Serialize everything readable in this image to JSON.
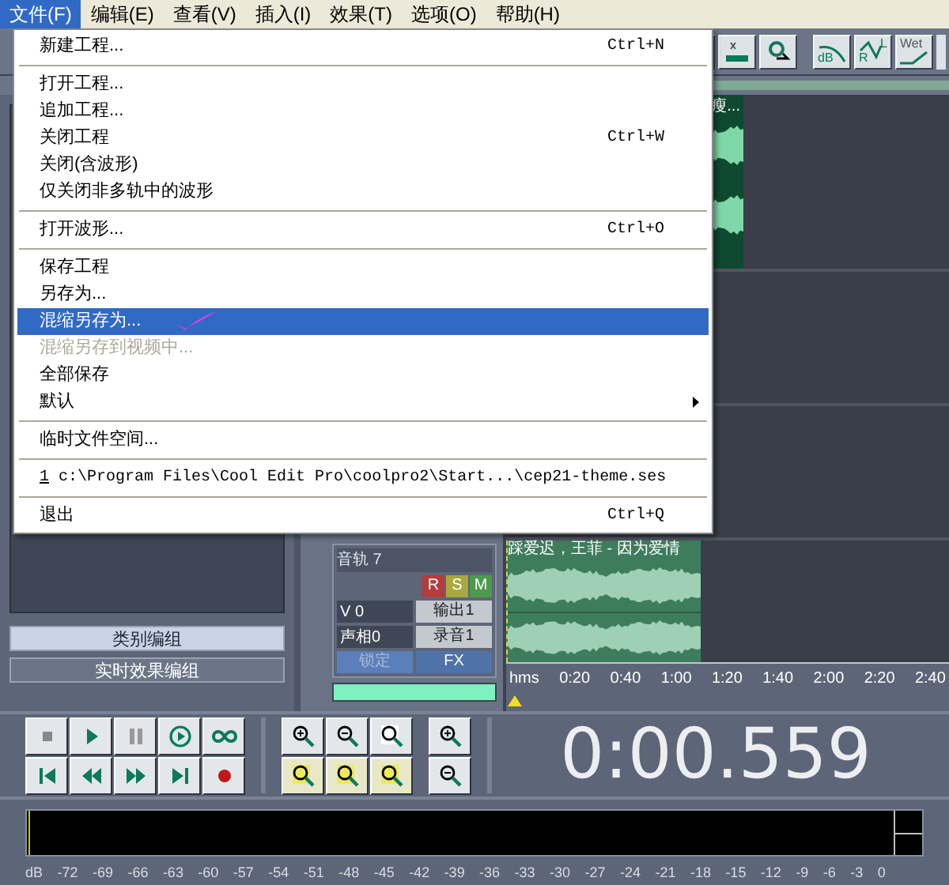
{
  "menubar": [
    {
      "label": "文件(F)",
      "selected": true
    },
    {
      "label": "编辑(E)",
      "selected": false
    },
    {
      "label": "查看(V)",
      "selected": false
    },
    {
      "label": "插入(I)",
      "selected": false
    },
    {
      "label": "效果(T)",
      "selected": false
    },
    {
      "label": "选项(O)",
      "selected": false
    },
    {
      "label": "帮助(H)",
      "selected": false
    }
  ],
  "toolbar_labels": {
    "db": "dB",
    "right": "R",
    "left": "L",
    "wet": "Wet"
  },
  "file_menu": [
    {
      "kind": "item",
      "label": "新建工程...",
      "shortcut": "Ctrl+N",
      "selected": false,
      "disabled": false,
      "submenu": false
    },
    {
      "kind": "separator"
    },
    {
      "kind": "item",
      "label": "打开工程...",
      "selected": false,
      "disabled": false,
      "submenu": false
    },
    {
      "kind": "item",
      "label": "追加工程...",
      "selected": false,
      "disabled": false,
      "submenu": false
    },
    {
      "kind": "item",
      "label": "关闭工程",
      "shortcut": "Ctrl+W",
      "selected": false,
      "disabled": false,
      "submenu": false
    },
    {
      "kind": "item",
      "label": "关闭(含波形)",
      "selected": false,
      "disabled": false,
      "submenu": false
    },
    {
      "kind": "item",
      "label": "仅关闭非多轨中的波形",
      "selected": false,
      "disabled": false,
      "submenu": false
    },
    {
      "kind": "separator"
    },
    {
      "kind": "item",
      "label": "打开波形...",
      "shortcut": "Ctrl+O",
      "selected": false,
      "disabled": false,
      "submenu": false
    },
    {
      "kind": "separator"
    },
    {
      "kind": "item",
      "label": "保存工程",
      "selected": false,
      "disabled": false,
      "submenu": false
    },
    {
      "kind": "item",
      "label": "另存为...",
      "selected": false,
      "disabled": false,
      "submenu": false
    },
    {
      "kind": "item",
      "label": "混缩另存为...",
      "selected": true,
      "disabled": false,
      "submenu": false
    },
    {
      "kind": "item",
      "label": "混缩另存到视频中...",
      "selected": false,
      "disabled": true,
      "submenu": false
    },
    {
      "kind": "item",
      "label": "全部保存",
      "selected": false,
      "disabled": false,
      "submenu": false
    },
    {
      "kind": "item",
      "label": "默认",
      "selected": false,
      "disabled": false,
      "submenu": true
    },
    {
      "kind": "separator"
    },
    {
      "kind": "item",
      "label": "临时文件空间...",
      "selected": false,
      "disabled": false,
      "submenu": false
    },
    {
      "kind": "separator"
    },
    {
      "kind": "recent",
      "number": "1",
      "label": "c:\\Program Files\\Cool Edit Pro\\coolpro2\\Start...\\cep21-theme.ses",
      "selected": false,
      "disabled": false,
      "submenu": false
    },
    {
      "kind": "separator"
    },
    {
      "kind": "item",
      "label": "退出",
      "shortcut": "Ctrl+Q",
      "selected": false,
      "disabled": false,
      "submenu": false
    }
  ],
  "tracks": {
    "top_clip_title": "瘦...",
    "bottom_clip_title": "踩爱迟，王菲 - 因为爱情"
  },
  "mixer": {
    "track_name": "音轨 7",
    "record": "R",
    "solo": "S",
    "mute": "M",
    "volume": "V 0",
    "output": "输出1",
    "pan": "声相0",
    "input": "录音1",
    "lock": "锁定",
    "fx": "FX"
  },
  "left_panel": {
    "buttons": [
      "类别编组",
      "实时效果编组"
    ]
  },
  "timeline": [
    "hms",
    "0:20",
    "0:40",
    "1:00",
    "1:20",
    "1:40",
    "2:00",
    "2:20",
    "2:40"
  ],
  "time_display": "0:00.559",
  "meter_scale": [
    "dB",
    "-72",
    "-69",
    "-66",
    "-63",
    "-60",
    "-57",
    "-54",
    "-51",
    "-48",
    "-45",
    "-42",
    "-39",
    "-36",
    "-33",
    "-30",
    "-27",
    "-24",
    "-21",
    "-18",
    "-15",
    "-12",
    "-9",
    "-6",
    "-3",
    "0"
  ]
}
